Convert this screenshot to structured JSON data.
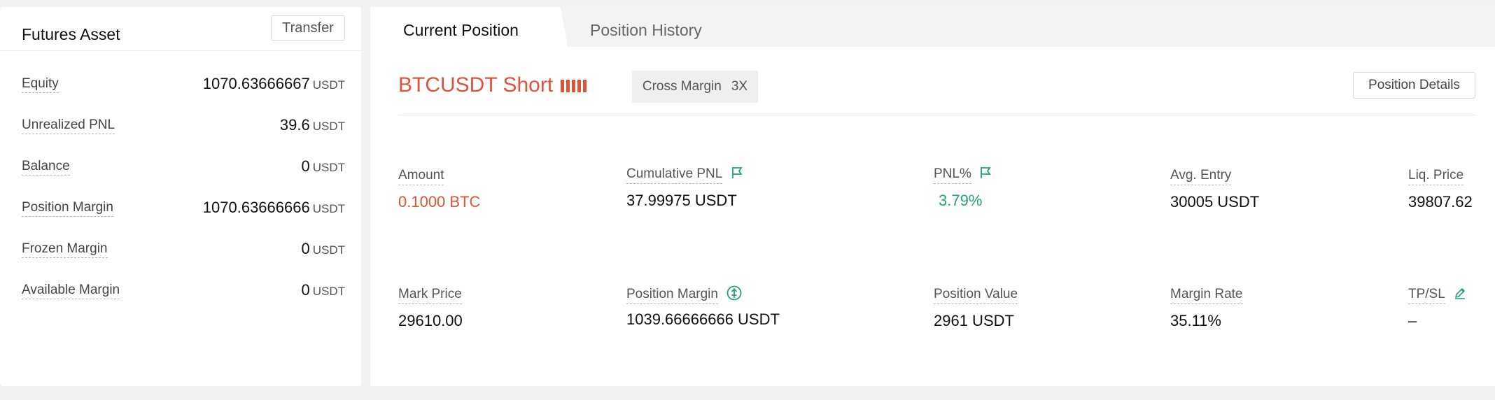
{
  "assets": {
    "title": "Futures Asset",
    "transfer_label": "Transfer",
    "rows": [
      {
        "label": "Equity",
        "value": "1070.63666667",
        "unit": "USDT"
      },
      {
        "label": "Unrealized PNL",
        "value": "39.6",
        "unit": "USDT"
      },
      {
        "label": "Balance",
        "value": "0",
        "unit": "USDT"
      },
      {
        "label": "Position Margin",
        "value": "1070.63666666",
        "unit": "USDT"
      },
      {
        "label": "Frozen Margin",
        "value": "0",
        "unit": "USDT"
      },
      {
        "label": "Available Margin",
        "value": "0",
        "unit": "USDT"
      }
    ]
  },
  "tabs": {
    "current": "Current Position",
    "history": "Position History"
  },
  "position": {
    "title": "BTCUSDT Short",
    "margin_mode": "Cross Margin",
    "leverage": "3X",
    "details_label": "Position Details",
    "amount_label": "Amount",
    "amount_value": "0.1000 BTC",
    "cum_pnl_label": "Cumulative PNL",
    "cum_pnl_value": "37.99975 USDT",
    "pnl_pct_label": "PNL%",
    "pnl_pct_value": "3.79%",
    "avg_entry_label": "Avg. Entry",
    "avg_entry_value": "30005 USDT",
    "liq_price_label": "Liq. Price",
    "liq_price_value": "39807.62",
    "mark_price_label": "Mark Price",
    "mark_price_value": "29610.00",
    "pos_margin_label": "Position Margin",
    "pos_margin_value": "1039.66666666 USDT",
    "pos_value_label": "Position Value",
    "pos_value_value": "2961 USDT",
    "margin_rate_label": "Margin Rate",
    "margin_rate_value": "35.11%",
    "tpsl_label": "TP/SL",
    "tpsl_value": "–"
  },
  "colors": {
    "short_red": "#e0533b",
    "profit_green": "#26a17b"
  },
  "icons": {
    "cum_pnl": "flag-icon",
    "pnl_pct": "flag-icon",
    "pos_margin": "dollar-circle-icon",
    "tpsl": "pencil-icon"
  }
}
